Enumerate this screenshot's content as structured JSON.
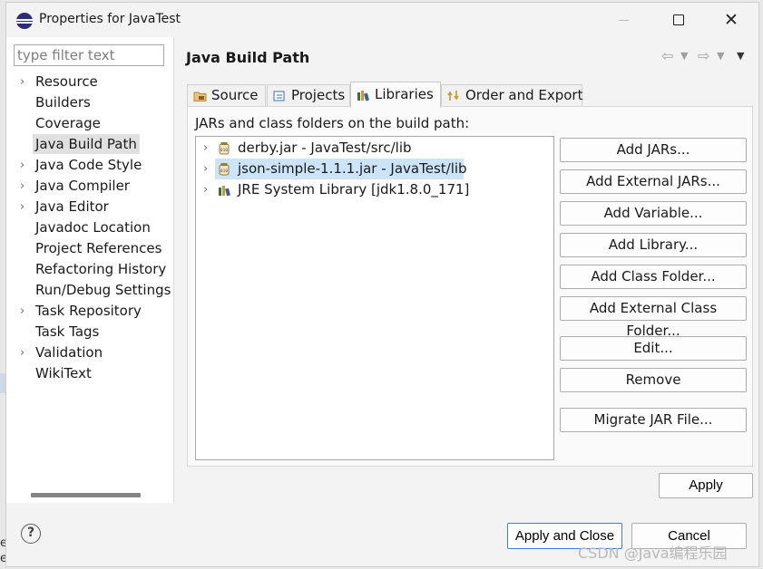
{
  "window": {
    "title": "Properties for JavaTest"
  },
  "left": {
    "filter_placeholder": "type filter text",
    "items": [
      {
        "label": "Resource",
        "expandable": true
      },
      {
        "label": "Builders",
        "expandable": false
      },
      {
        "label": "Coverage",
        "expandable": false
      },
      {
        "label": "Java Build Path",
        "expandable": false,
        "selected": true
      },
      {
        "label": "Java Code Style",
        "expandable": true
      },
      {
        "label": "Java Compiler",
        "expandable": true
      },
      {
        "label": "Java Editor",
        "expandable": true
      },
      {
        "label": "Javadoc Location",
        "expandable": false
      },
      {
        "label": "Project References",
        "expandable": false
      },
      {
        "label": "Refactoring History",
        "expandable": false
      },
      {
        "label": "Run/Debug Settings",
        "expandable": false
      },
      {
        "label": "Task Repository",
        "expandable": true
      },
      {
        "label": "Task Tags",
        "expandable": false
      },
      {
        "label": "Validation",
        "expandable": true
      },
      {
        "label": "WikiText",
        "expandable": false
      }
    ]
  },
  "main": {
    "title": "Java Build Path",
    "tabs": [
      {
        "label": "Source"
      },
      {
        "label": "Projects"
      },
      {
        "label": "Libraries",
        "active": true
      },
      {
        "label": "Order and Export"
      }
    ],
    "section_label": "JARs and class folders on the build path:",
    "libraries": [
      {
        "label": "derby.jar - JavaTest/src/lib",
        "icon": "jar-icon"
      },
      {
        "label": "json-simple-1.1.1.jar - JavaTest/lib",
        "icon": "jar-icon",
        "selected": true
      },
      {
        "label": "JRE System Library [jdk1.8.0_171]",
        "icon": "library-icon"
      }
    ],
    "buttons": {
      "add_jars": "Add JARs...",
      "add_external_jars": "Add External JARs...",
      "add_variable": "Add Variable...",
      "add_library": "Add Library...",
      "add_class_folder": "Add Class Folder...",
      "add_external_class_folder": "Add External Class Folder...",
      "edit": "Edit...",
      "remove": "Remove",
      "migrate_jar": "Migrate JAR File..."
    },
    "apply": "Apply"
  },
  "footer": {
    "help": "?",
    "apply_and_close": "Apply and Close",
    "cancel": "Cancel"
  },
  "watermark": "CSDN @Java编程乐园",
  "edge_text": [
    "e",
    "e"
  ],
  "colors": {
    "selection": "#cce4f7",
    "default_button_border": "#3b7fd1"
  }
}
